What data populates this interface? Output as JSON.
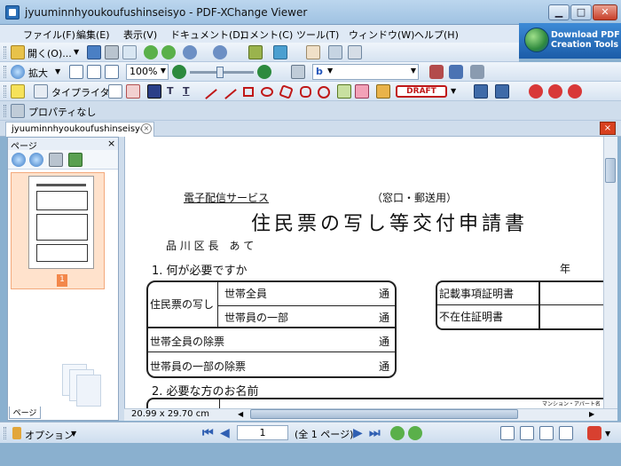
{
  "window": {
    "title": "jyuuminnhyoukoufushinseisyo - PDF-XChange Viewer",
    "min": "▁",
    "max": "□",
    "close": "✕"
  },
  "menus": [
    "ファイル(F)",
    "編集(E)",
    "表示(V)",
    "ドキュメント(D)",
    "コメント(C)",
    "ツール(T)",
    "ウィンドウ(W)",
    "ヘルプ(H)"
  ],
  "banner": {
    "line1": "Download PDF",
    "line2": "Creation Tools"
  },
  "toolbar": {
    "open_label": "開く(O)...",
    "zoom_label": "拡大",
    "zoom_value": "100%",
    "typewriter_label": "タイプライター",
    "draft_stamp": "DRAFT",
    "properties_label": "プロパティなし"
  },
  "tab": {
    "name": "jyuuminnhyoukoufushinseisyo",
    "close": "×",
    "doc_close": "×"
  },
  "pages_pane": {
    "title": "ページ",
    "close": "×",
    "tab_label": "ページ",
    "thumb_number": "1"
  },
  "status": {
    "page_size": "20.99 x 29.70 cm"
  },
  "nav": {
    "options_label": "オプション",
    "page_value": "1",
    "page_total": "(全 1 ページ)"
  },
  "document": {
    "service": "電子配信サービス",
    "window_mail": "（窓口・郵送用）",
    "heading": "住民票の写し等交付申請書",
    "addressee": "品 川 区 長　あ て",
    "year": "年",
    "q1": "1. 何が必要ですか",
    "q2": "2. 必要な方のお名前",
    "juminhyo": "住民票の写し",
    "rows": [
      {
        "label": "世帯全員",
        "unit": "通"
      },
      {
        "label": "世帯員の一部",
        "unit": "通"
      },
      {
        "label": "世帯全員の除票",
        "unit": "通"
      },
      {
        "label": "世帯員の一部の除票",
        "unit": "通"
      }
    ],
    "right_rows": [
      "記載事項証明書",
      "不在住証明書"
    ],
    "mansion": "マンション・アパート名"
  }
}
